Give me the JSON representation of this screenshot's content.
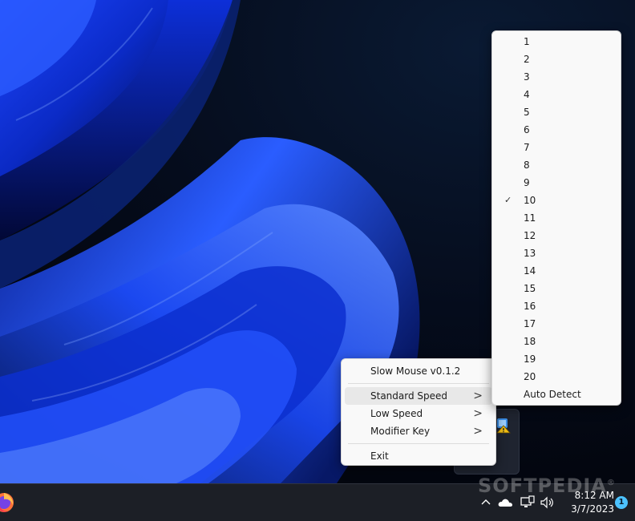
{
  "menu": {
    "title": "Slow Mouse v0.1.2",
    "items": [
      {
        "label": "Standard Speed",
        "submenu_indicator": ">"
      },
      {
        "label": "Low Speed",
        "submenu_indicator": ">"
      },
      {
        "label": "Modifier Key",
        "submenu_indicator": ">"
      }
    ],
    "exit": "Exit",
    "hovered_item": "Standard Speed"
  },
  "speed_submenu": {
    "items": [
      "1",
      "2",
      "3",
      "4",
      "5",
      "6",
      "7",
      "8",
      "9",
      "10",
      "11",
      "12",
      "13",
      "14",
      "15",
      "16",
      "17",
      "18",
      "19",
      "20",
      "Auto Detect"
    ],
    "checked": "10",
    "check_mark": "✓"
  },
  "taskbar": {
    "time": "8:12 AM",
    "date": "3/7/2023",
    "notification_count": "1",
    "tray_icons": [
      "chevron-up-icon",
      "onedrive-cloud-icon",
      "network-icon",
      "volume-icon"
    ]
  },
  "watermark": {
    "text": "SOFTPEDIA",
    "mark": "®"
  },
  "colors": {
    "menu_bg": "#f9f9f9",
    "menu_hover": "#e8e8e8",
    "taskbar_bg": "#1c1f26",
    "badge": "#4cc2ff",
    "wallpaper_blue": "#1a3cff"
  }
}
